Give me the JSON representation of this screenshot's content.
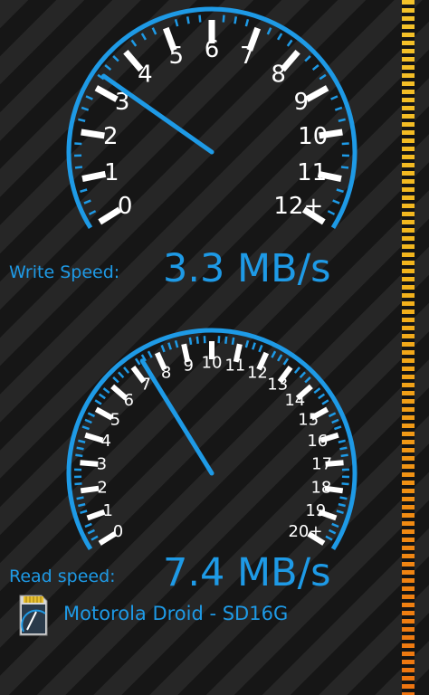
{
  "theme": {
    "accent": "#1e9ae6",
    "tick_color": "#ffffff",
    "level_bar_colors": [
      "#f4c22a",
      "#f08a12"
    ]
  },
  "write_gauge": {
    "scale_labels": [
      "0",
      "1",
      "2",
      "3",
      "4",
      "5",
      "6",
      "7",
      "8",
      "9",
      "10",
      "11",
      "12+"
    ],
    "needle_value": 3.3,
    "label": "Write Speed:",
    "value_text": "3.3 MB/s"
  },
  "read_gauge": {
    "scale_labels": [
      "0",
      "1",
      "2",
      "3",
      "4",
      "5",
      "6",
      "7",
      "8",
      "9",
      "10",
      "11",
      "12",
      "13",
      "14",
      "15",
      "16",
      "17",
      "18",
      "19",
      "20+"
    ],
    "needle_value": 7.4,
    "label": "Read speed:",
    "value_text": "7.4 MB/s"
  },
  "device": {
    "name": "Motorola Droid - SD16G",
    "icon": "sd-card-gauge-icon"
  },
  "level_indicator": {
    "icon": "level-meter-bar"
  }
}
